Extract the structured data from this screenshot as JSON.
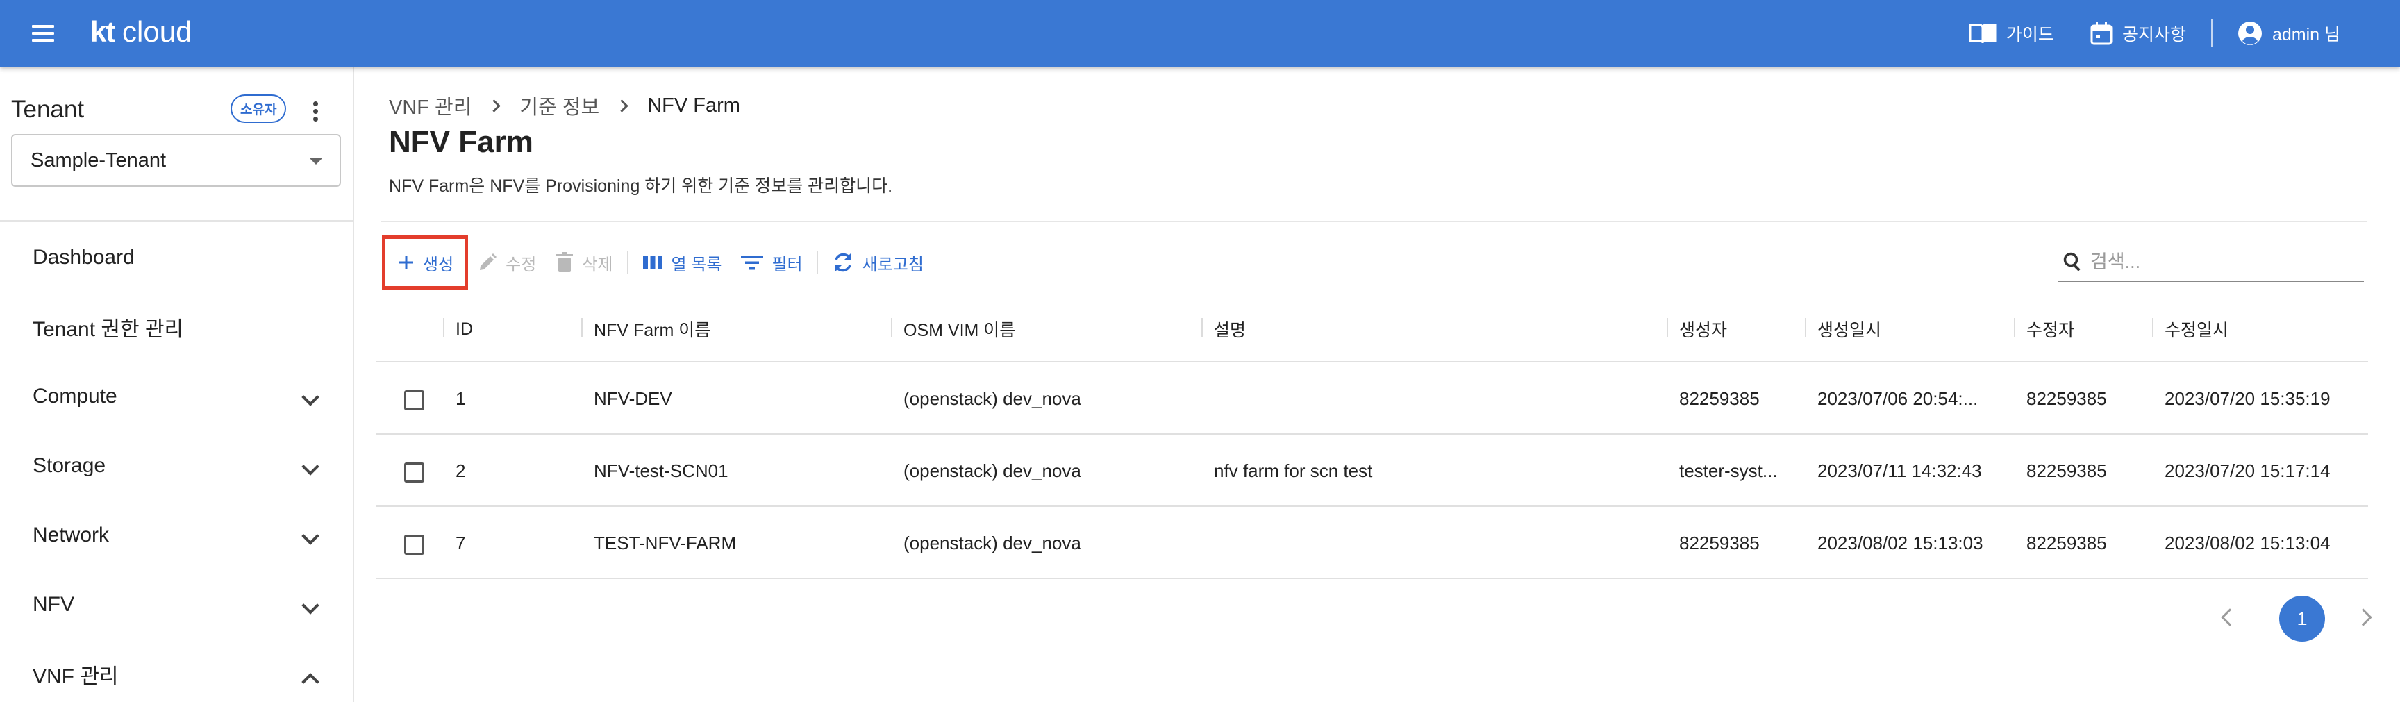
{
  "topbar": {
    "logo_kt": "kt",
    "logo_cloud": "cloud",
    "guide_label": "가이드",
    "notice_label": "공지사항",
    "user_label": "admin 님"
  },
  "sidebar": {
    "tenant_heading": "Tenant",
    "owner_badge": "소유자",
    "tenant_selected": "Sample-Tenant",
    "items": [
      {
        "label": "Dashboard",
        "expandable": false
      },
      {
        "label": "Tenant 권한 관리",
        "expandable": false
      },
      {
        "label": "Compute",
        "expandable": true,
        "expanded": false
      },
      {
        "label": "Storage",
        "expandable": true,
        "expanded": false
      },
      {
        "label": "Network",
        "expandable": true,
        "expanded": false
      },
      {
        "label": "NFV",
        "expandable": true,
        "expanded": false
      },
      {
        "label": "VNF 관리",
        "expandable": true,
        "expanded": true
      }
    ]
  },
  "breadcrumb": [
    "VNF 관리",
    "기준 정보",
    "NFV Farm"
  ],
  "page": {
    "title": "NFV Farm",
    "description": "NFV Farm은 NFV를 Provisioning 하기 위한 기준 정보를 관리합니다."
  },
  "toolbar": {
    "create": "생성",
    "edit": "수정",
    "delete": "삭제",
    "columns": "열 목록",
    "filter": "필터",
    "refresh": "새로고침",
    "search_placeholder": "검색..."
  },
  "table": {
    "headers": [
      "ID",
      "NFV Farm 이름",
      "OSM VIM 이름",
      "설명",
      "생성자",
      "생성일시",
      "수정자",
      "수정일시"
    ],
    "rows": [
      [
        "1",
        "NFV-DEV",
        "(openstack) dev_nova",
        "",
        "82259385",
        "2023/07/06 20:54:...",
        "82259385",
        "2023/07/20 15:35:19"
      ],
      [
        "2",
        "NFV-test-SCN01",
        "(openstack) dev_nova",
        "nfv farm for scn test",
        "tester-syst...",
        "2023/07/11 14:32:43",
        "82259385",
        "2023/07/20 15:17:14"
      ],
      [
        "7",
        "TEST-NFV-FARM",
        "(openstack) dev_nova",
        "",
        "82259385",
        "2023/08/02 15:13:03",
        "82259385",
        "2023/08/02 15:13:04"
      ]
    ]
  },
  "pagination": {
    "current": "1"
  },
  "colors": {
    "topbar": "#3a78d3",
    "accent": "#2f6cd0",
    "highlight": "#e33d2c"
  }
}
